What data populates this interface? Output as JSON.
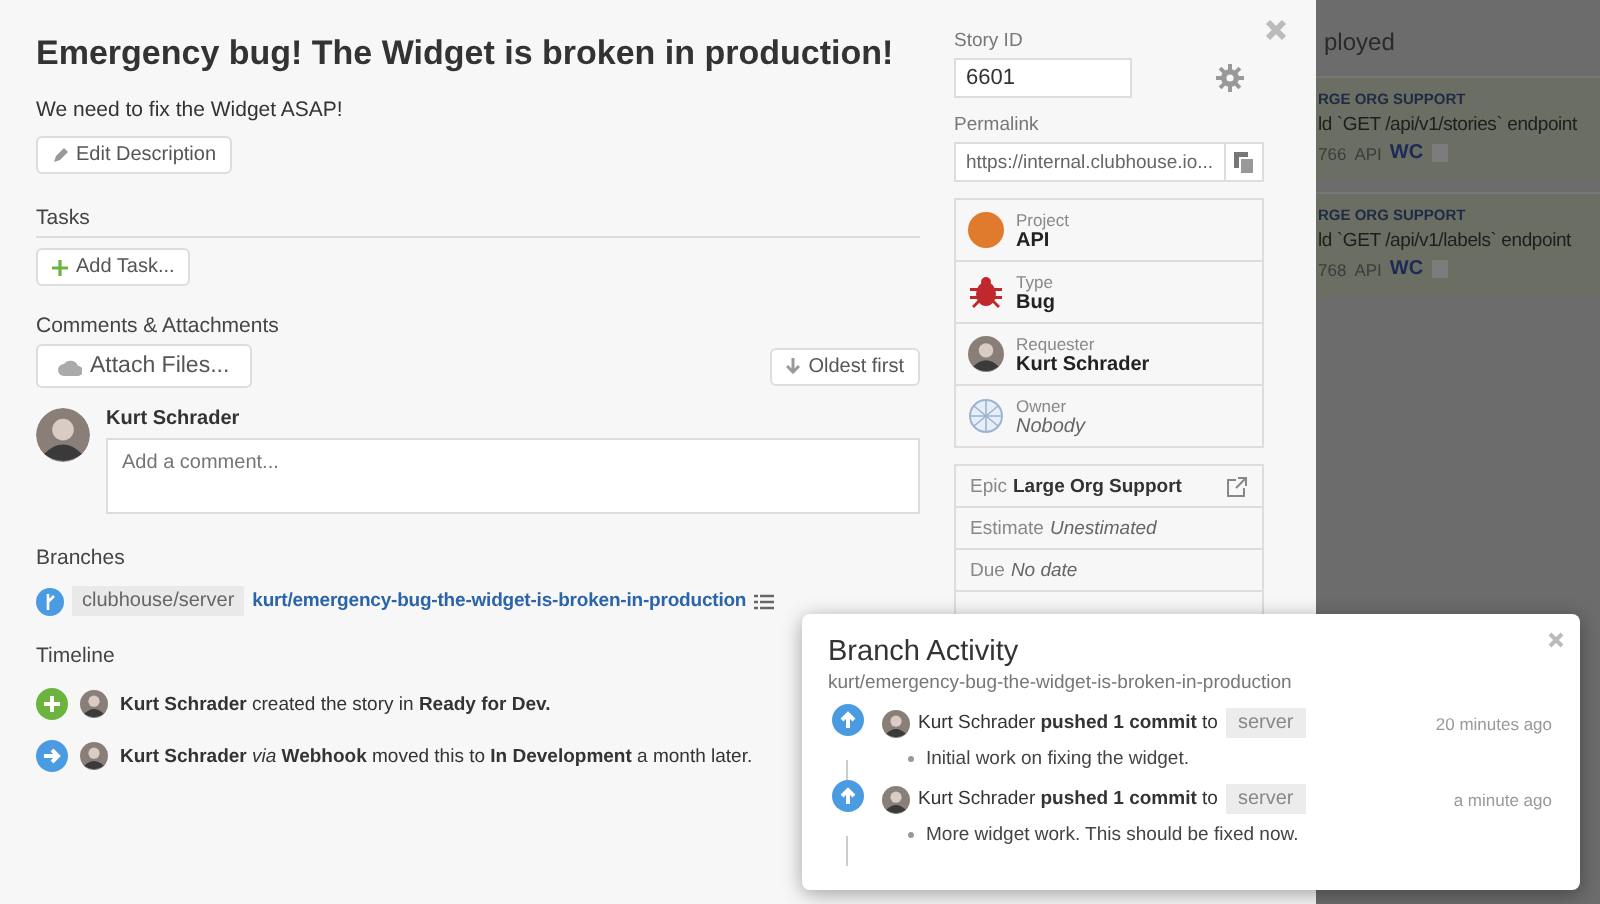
{
  "story": {
    "title": "Emergency bug! The Widget is broken in production!",
    "description": "We need to fix the Widget ASAP!",
    "edit_button": "Edit Description",
    "tasks_heading": "Tasks",
    "add_task_button": "Add Task...",
    "comments_heading": "Comments & Attachments",
    "attach_button": "Attach Files...",
    "sort_button": "Oldest first",
    "commenter": "Kurt Schrader",
    "comment_placeholder": "Add a comment...",
    "branches_heading": "Branches",
    "branch": {
      "repo": "clubhouse/server",
      "name": "kurt/emergency-bug-the-widget-is-broken-in-production"
    },
    "timeline_heading": "Timeline",
    "timeline": [
      {
        "kind": "created",
        "text": "**Kurt Schrader** created the story in **Ready for Dev.**"
      },
      {
        "kind": "moved",
        "text": "**Kurt Schrader** *via* **Webhook** moved this to **In Development** a month later."
      }
    ]
  },
  "sidebar": {
    "story_id_label": "Story ID",
    "story_id": "6601",
    "permalink_label": "Permalink",
    "permalink": "https://internal.clubhouse.io...",
    "fields": [
      {
        "kind": "project",
        "label": "Project",
        "value": "API",
        "empty": false
      },
      {
        "kind": "type",
        "label": "Type",
        "value": "Bug",
        "empty": false
      },
      {
        "kind": "requester",
        "label": "Requester",
        "value": "Kurt Schrader",
        "empty": false
      },
      {
        "kind": "owner",
        "label": "Owner",
        "value": "Nobody",
        "empty": true
      }
    ],
    "details": [
      {
        "label": "Epic",
        "value": "Large Org Support",
        "empty": false,
        "link": true
      },
      {
        "label": "Estimate",
        "value": "Unestimated",
        "empty": true,
        "link": false
      },
      {
        "label": "Due",
        "value": "No date",
        "empty": true,
        "link": false
      }
    ]
  },
  "board": {
    "column_title": "ployed",
    "cards": [
      {
        "epic": "RGE ORG SUPPORT",
        "title": "ld `GET /api/v1/stories` endpoint",
        "id": "766",
        "project": "API",
        "owner": "WC"
      },
      {
        "epic": "RGE ORG SUPPORT",
        "title": "ld `GET /api/v1/labels` endpoint",
        "id": "768",
        "project": "API",
        "owner": "WC"
      }
    ]
  },
  "popup": {
    "title": "Branch Activity",
    "branch": "kurt/emergency-bug-the-widget-is-broken-in-production",
    "events": [
      {
        "text": "Kurt Schrader **pushed 1 commit** to",
        "repo": "server",
        "time": "20 minutes ago",
        "commits": [
          "Initial work on fixing the widget."
        ]
      },
      {
        "text": "Kurt Schrader **pushed 1 commit** to",
        "repo": "server",
        "time": "a minute ago",
        "commits": [
          "More widget work. This should be fixed now."
        ]
      }
    ]
  }
}
